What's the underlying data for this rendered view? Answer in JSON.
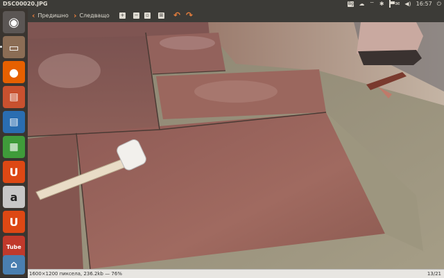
{
  "window": {
    "title": "DSC00020.JPG"
  },
  "indicators": {
    "keyboard_layout": "Bg",
    "clock": "16:57"
  },
  "toolbar": {
    "prev_label": "Предишно",
    "next_label": "Следващо"
  },
  "status": {
    "info": "1600×1200 пиксела, 236.2kb — 76%",
    "position": "13/21"
  },
  "launcher": {
    "items": [
      {
        "icon": "ubuntu-dash-icon",
        "glyph": "◉",
        "color": "#6a6562"
      },
      {
        "icon": "file-manager-icon",
        "glyph": "▭",
        "color": "#8b6d55"
      },
      {
        "icon": "firefox-icon",
        "glyph": "●",
        "color": "#e66000"
      },
      {
        "icon": "impress-icon",
        "glyph": "▤",
        "color": "#c8512f"
      },
      {
        "icon": "writer-icon",
        "glyph": "▤",
        "color": "#2a6db0"
      },
      {
        "icon": "calc-icon",
        "glyph": "▦",
        "color": "#3f9b3a"
      },
      {
        "icon": "ubuntu-software-center-icon",
        "glyph": "U",
        "color": "#dd4814"
      },
      {
        "icon": "amazon-icon",
        "glyph": "a",
        "color": "#c7c7c7"
      },
      {
        "icon": "ubuntu-one-icon",
        "glyph": "U",
        "color": "#dd4814"
      },
      {
        "icon": "youtube-icon",
        "glyph": "Tube",
        "color": "#c0392b"
      },
      {
        "icon": "trash-icon",
        "glyph": "⌂",
        "color": "#8a8a8a"
      }
    ]
  },
  "accent_color": "#e67e3c",
  "photo": {
    "description_icon": "image-viewer-photo"
  }
}
